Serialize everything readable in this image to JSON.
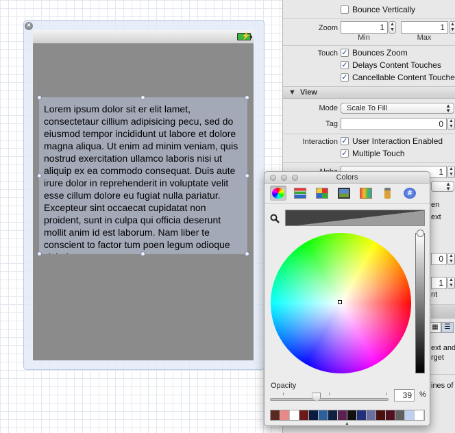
{
  "canvas": {
    "close_glyph": "×",
    "text_view": {
      "content": "Lorem ipsum dolor sit er elit lamet, consectetaur cillium adipisicing pecu, sed do eiusmod tempor incididunt ut labore et dolore magna aliqua. Ut enim ad minim veniam, quis nostrud exercitation ullamco laboris nisi ut aliquip ex ea commodo consequat. Duis aute irure dolor in reprehenderit in voluptate velit esse cillum dolore eu fugiat nulla pariatur. Excepteur sint occaecat cupidatat non proident, sunt in culpa qui officia deserunt mollit anim id est laborum. Nam liber te conscient to factor tum poen legum odioque civiuda."
    },
    "view_background": "#8b8b8b",
    "text_view_background": "#a4a9b8"
  },
  "inspector": {
    "bounce_vertically": {
      "label": "Bounce Vertically",
      "checked": false
    },
    "zoom": {
      "label": "Zoom",
      "min_value": "1",
      "max_value": "1",
      "min_caption": "Min",
      "max_caption": "Max"
    },
    "touch": {
      "label": "Touch",
      "options": [
        {
          "label": "Bounces Zoom",
          "checked": true
        },
        {
          "label": "Delays Content Touches",
          "checked": true
        },
        {
          "label": "Cancellable Content Touches",
          "checked": true
        }
      ]
    },
    "view_section": {
      "header": "View",
      "mode": {
        "label": "Mode",
        "value": "Scale To Fill"
      },
      "tag": {
        "label": "Tag",
        "value": "0"
      },
      "interaction": {
        "label": "Interaction",
        "options": [
          {
            "label": "User Interaction Enabled",
            "checked": true
          },
          {
            "label": "Multiple Touch",
            "checked": true
          }
        ]
      },
      "alpha": {
        "label": "Alpha",
        "value": "1"
      }
    },
    "partial_texts": [
      "en",
      "ext",
      "nt",
      "ext and",
      "rget",
      "ines of"
    ],
    "partial_values": [
      "0",
      "1"
    ]
  },
  "colors_panel": {
    "title": "Colors",
    "modes": [
      {
        "name": "color-wheel",
        "selected": true
      },
      {
        "name": "color-sliders",
        "selected": false
      },
      {
        "name": "color-palettes",
        "selected": false
      },
      {
        "name": "image-palettes",
        "selected": false
      },
      {
        "name": "crayons",
        "selected": false
      },
      {
        "name": "paint-tube",
        "selected": false
      },
      {
        "name": "hex-picker",
        "selected": false
      }
    ],
    "hex_glyph": "#",
    "opacity_label": "Opacity",
    "opacity_value": "39",
    "opacity_unit": "%",
    "opacity_fraction": 0.39,
    "swatch_colors": [
      "#5a2a22",
      "#e88888",
      "#ffffff",
      "#6b1a1a",
      "#0a1a40",
      "#2d5f99",
      "#102040",
      "#5a2050",
      "#101010",
      "#20307a",
      "#6a6f9f",
      "#4a1010",
      "#501020",
      "#606060",
      "#c0d0f0",
      "#ffffff"
    ]
  }
}
